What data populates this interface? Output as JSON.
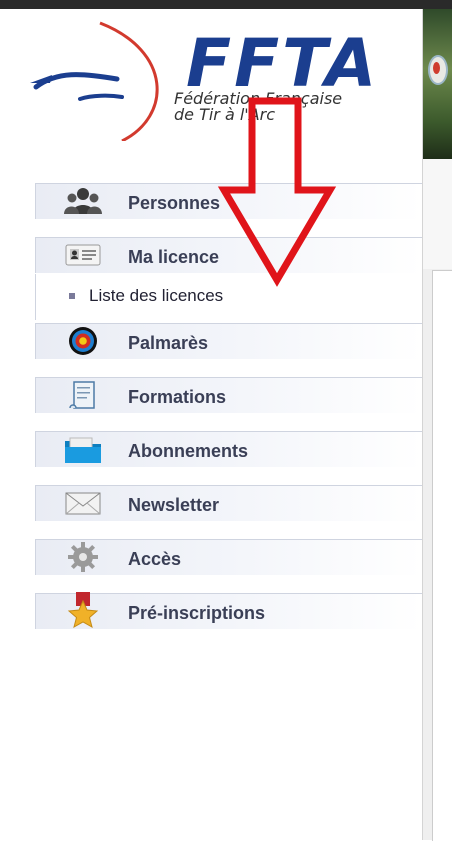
{
  "logo": {
    "acronym": "FFTA",
    "subtitle_line1": "Fédération Française",
    "subtitle_line2": "de Tir à l'Arc"
  },
  "sidebar": {
    "items": [
      {
        "label": "Personnes",
        "icon": "people-icon"
      },
      {
        "label": "Ma licence",
        "icon": "id-card-icon"
      },
      {
        "label": "Palmarès",
        "icon": "target-icon"
      },
      {
        "label": "Formations",
        "icon": "scroll-icon"
      },
      {
        "label": "Abonnements",
        "icon": "folder-icon"
      },
      {
        "label": "Newsletter",
        "icon": "envelope-icon"
      },
      {
        "label": "Accès",
        "icon": "gear-icon"
      },
      {
        "label": "Pré-inscriptions",
        "icon": "medal-icon"
      }
    ],
    "submenu": {
      "label": "Liste des licences"
    }
  },
  "colors": {
    "brand_blue": "#1b3e8f",
    "logo_red": "#d23a2e",
    "annotation_red": "#e0141a",
    "menu_text": "#3a3f56"
  }
}
